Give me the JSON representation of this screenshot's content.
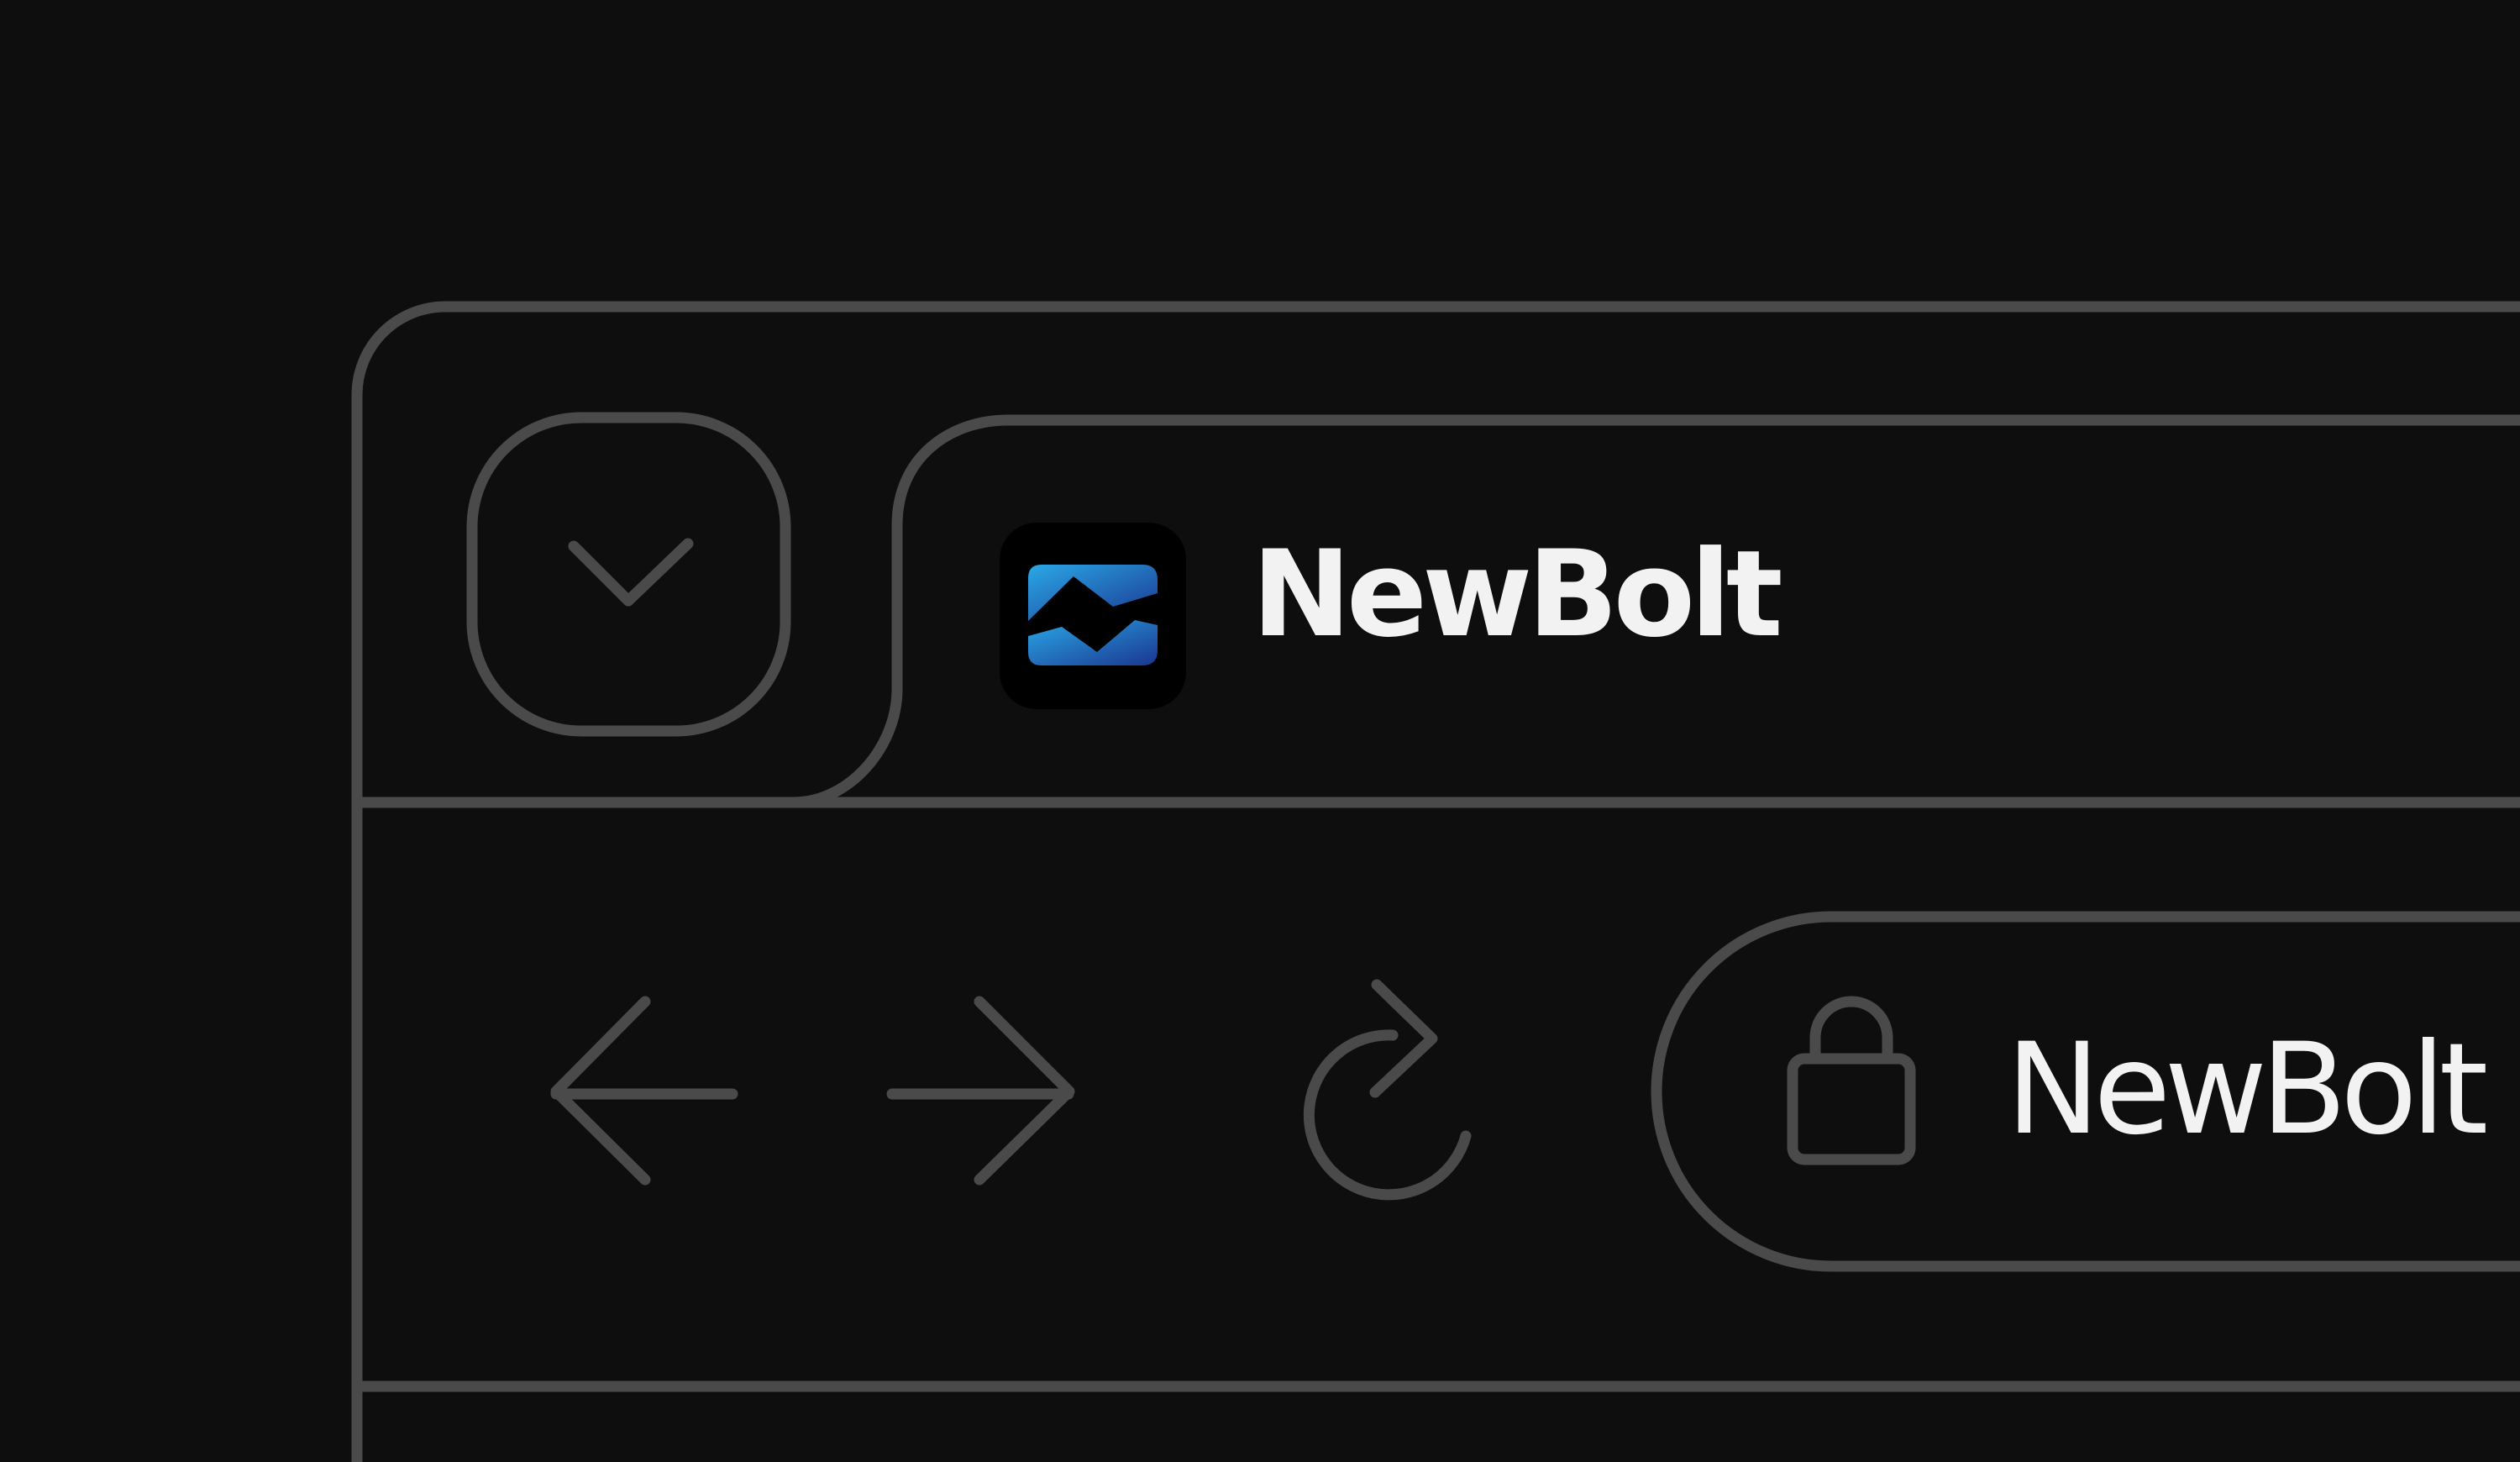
{
  "window": {
    "tab": {
      "title": "NewBolt",
      "favicon": "newbolt-logo",
      "dropdown_icon": "chevron-down-icon"
    },
    "toolbar": {
      "back_icon": "arrow-left-icon",
      "forward_icon": "arrow-right-icon",
      "reload_icon": "reload-icon",
      "address": {
        "lock_icon": "lock-icon",
        "text": "NewBolt"
      }
    }
  },
  "colors": {
    "background": "#0e0e0e",
    "outline": "#4a4a4a",
    "text": "#f2f2f2",
    "logo_gradient_start": "#2a9fe0",
    "logo_gradient_end": "#1c3a96"
  }
}
